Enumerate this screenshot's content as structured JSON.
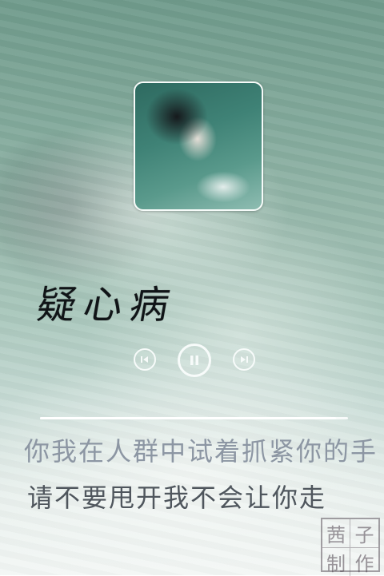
{
  "colors": {
    "icon": "#f7fbfa",
    "title": "#101417",
    "lyric_dim": "#8c96a3",
    "lyric_active": "#4f565d"
  },
  "player": {
    "song_title": "疑心病",
    "album_art_icon": "album-cover-photo",
    "controls": {
      "previous_icon": "skip-previous-icon",
      "pause_icon": "pause-icon",
      "next_icon": "skip-next-icon"
    },
    "progress": 0.96,
    "lyrics": [
      "你我在人群中试着抓紧你的手",
      "请不要甩开我不会让你走"
    ]
  },
  "watermark": {
    "chars": [
      "茜",
      "子",
      "制",
      "作"
    ]
  }
}
